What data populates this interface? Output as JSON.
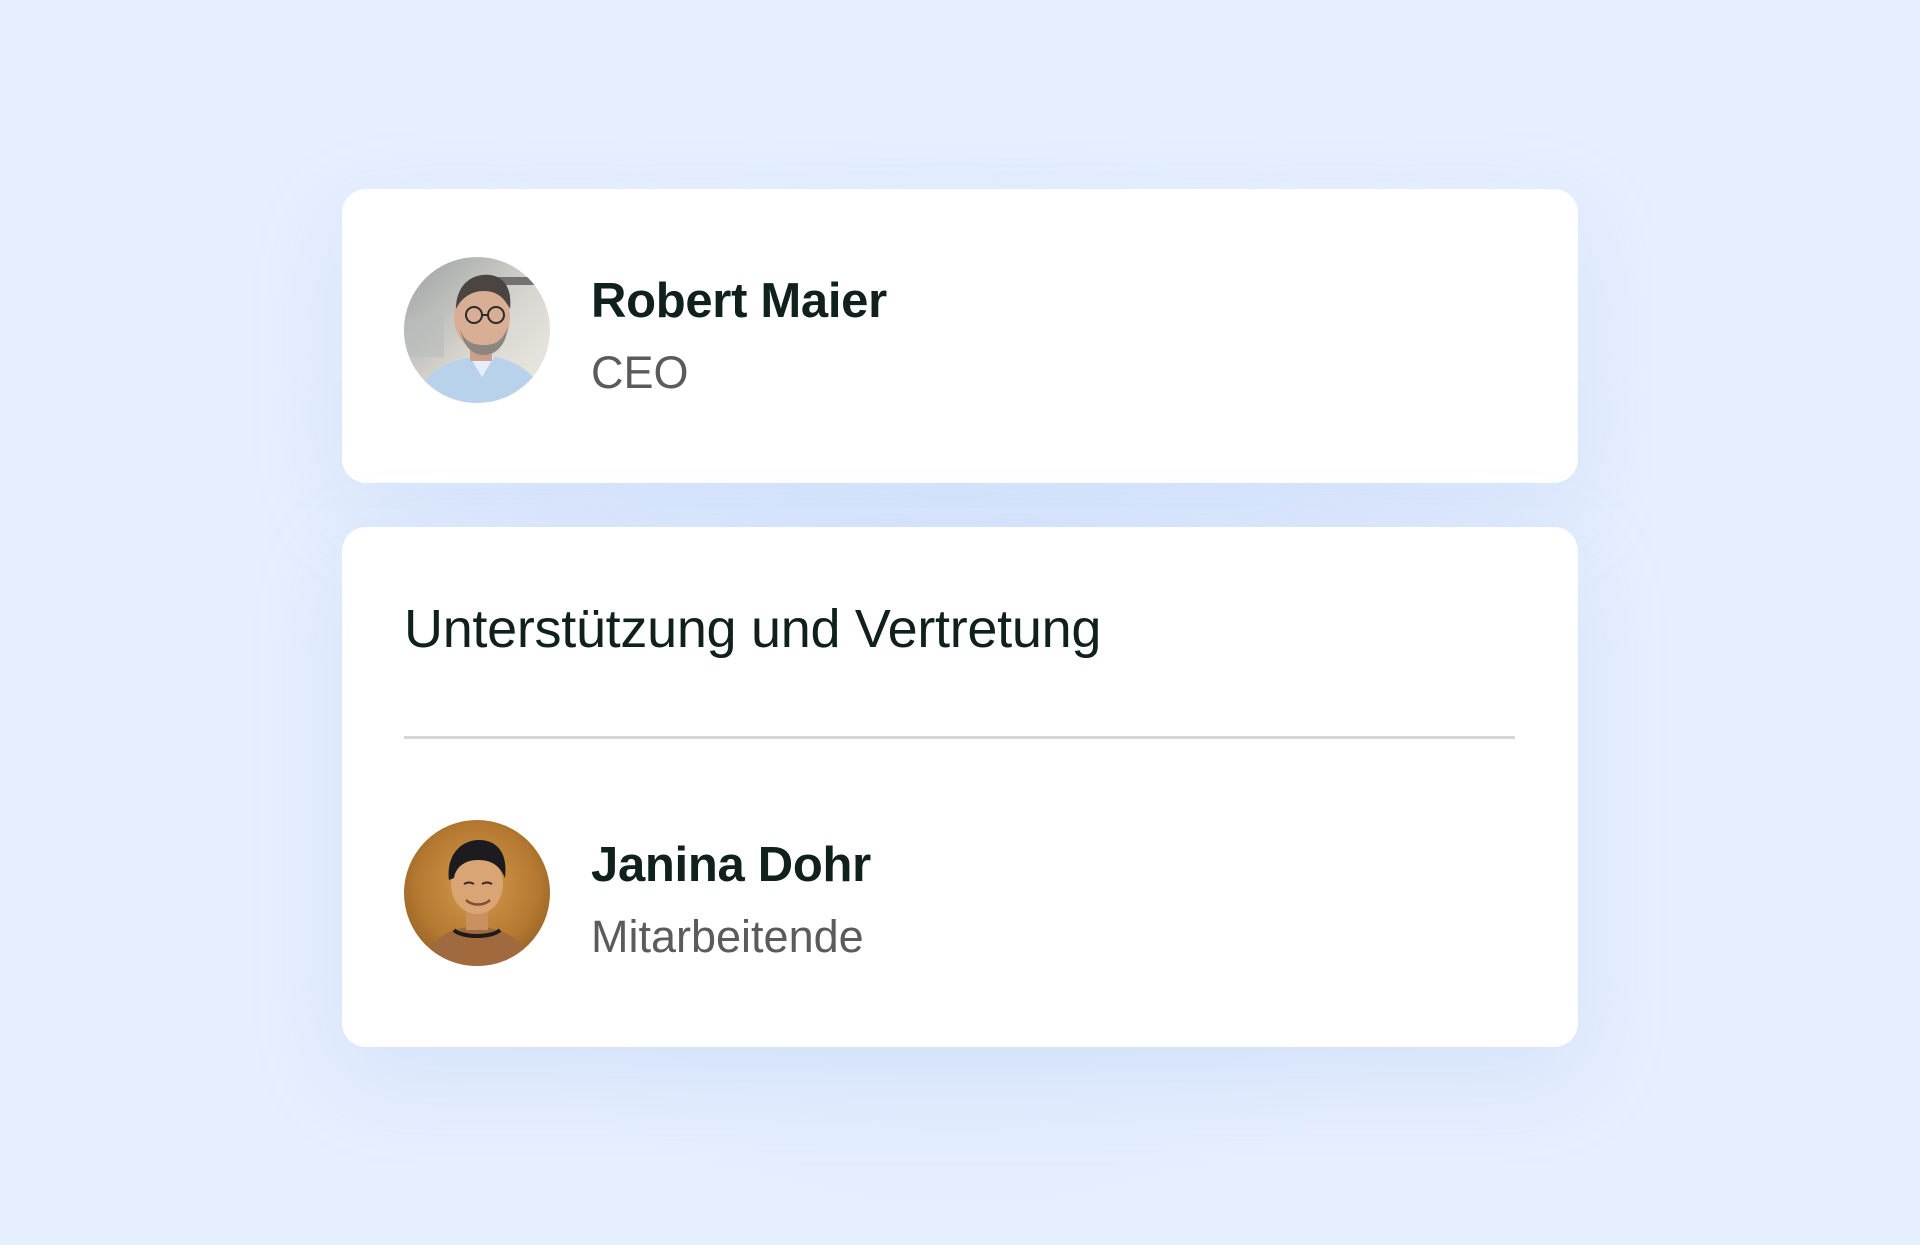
{
  "manager": {
    "name": "Robert Maier",
    "role": "CEO",
    "avatar_icon": "person-photo-man-glasses"
  },
  "support": {
    "title": "Unterstützung und Vertretung",
    "people": [
      {
        "name": "Janina Dohr",
        "role": "Mitarbeitende",
        "avatar_icon": "person-photo-woman-short-hair"
      }
    ]
  }
}
